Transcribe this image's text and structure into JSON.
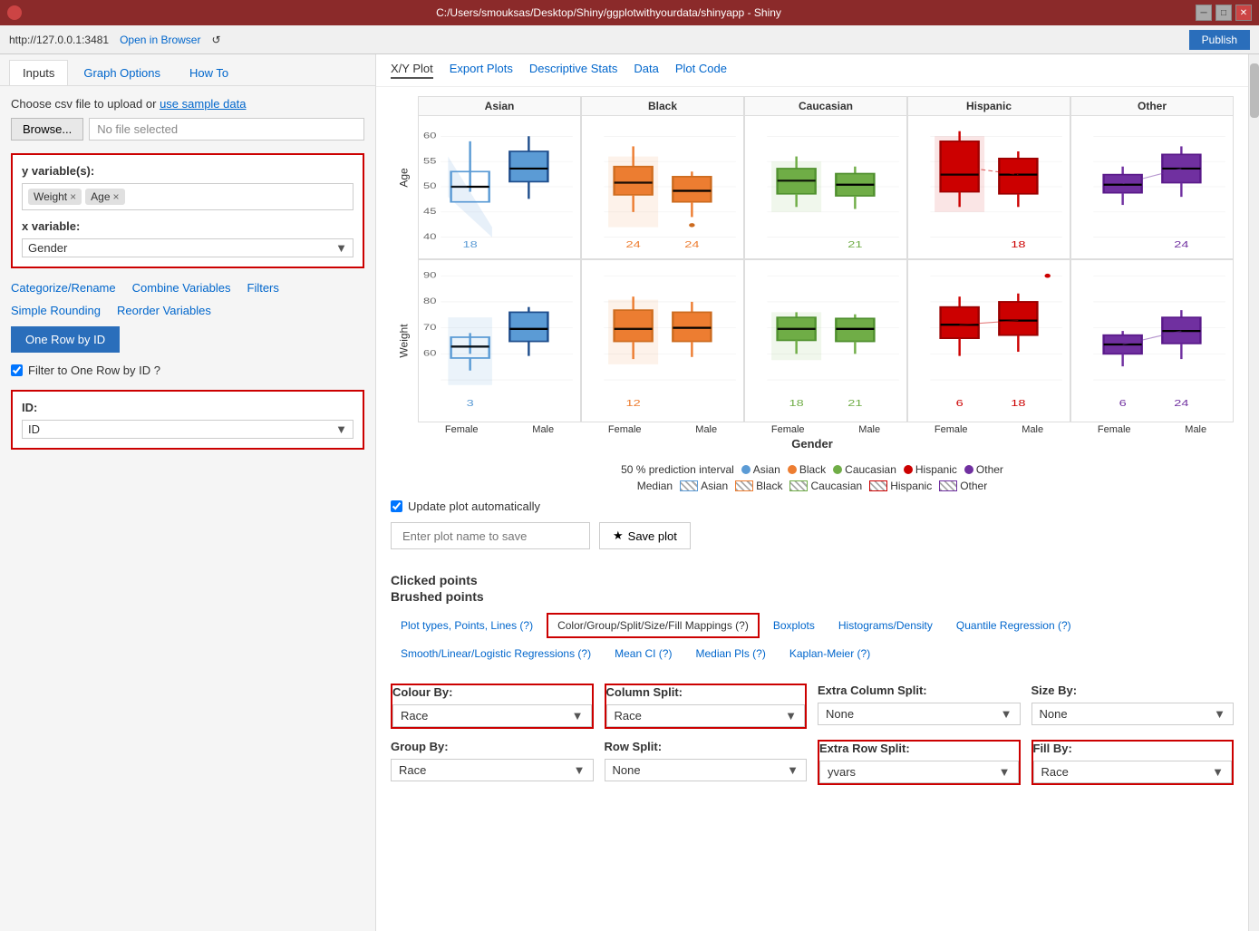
{
  "window": {
    "title": "C:/Users/smouksas/Desktop/Shiny/ggplotwithyourdata/shinyapp - Shiny",
    "url": "http://127.0.0.1:3481",
    "open_in_browser": "Open in Browser",
    "publish": "Publish"
  },
  "left_panel": {
    "tabs": [
      "Inputs",
      "Graph Options",
      "How To"
    ],
    "active_tab": "Inputs",
    "upload_label": "Choose csv file to upload",
    "upload_link": "use sample data",
    "browse_btn": "Browse...",
    "no_file": "No file selected",
    "y_variable_label": "y variable(s):",
    "y_tags": [
      "Weight",
      "Age"
    ],
    "x_variable_label": "x variable:",
    "x_value": "Gender",
    "links": [
      "Categorize/Rename",
      "Combine Variables",
      "Filters",
      "Simple Rounding",
      "Reorder Variables"
    ],
    "one_row_btn": "One Row by ID",
    "filter_checkbox": "Filter to One Row by ID ?",
    "id_label": "ID:",
    "id_value": "ID"
  },
  "right_panel": {
    "tabs": [
      "X/Y Plot",
      "Export Plots",
      "Descriptive Stats",
      "Data",
      "Plot Code"
    ],
    "active_tab": "X/Y Plot",
    "facet_columns": [
      "Asian",
      "Black",
      "Caucasian",
      "Hispanic",
      "Other"
    ],
    "facet_rows": [
      "Age",
      "Weight"
    ],
    "x_axis_title": "Gender",
    "x_labels": [
      "Female",
      "Male"
    ],
    "prediction_label": "50 % prediction interval",
    "legend_groups": [
      {
        "name": "Asian",
        "color": "#5b9bd5"
      },
      {
        "name": "Black",
        "color": "#ed7d31"
      },
      {
        "name": "Caucasian",
        "color": "#70ad47"
      },
      {
        "name": "Hispanic",
        "color": "#cc0000"
      },
      {
        "name": "Other",
        "color": "#7030a0"
      }
    ],
    "median_label": "Median",
    "median_groups": [
      "Asian",
      "Black",
      "Caucasian",
      "Hispanic",
      "Other"
    ],
    "update_checkbox": "Update plot automatically",
    "save_placeholder": "Enter plot name to save",
    "save_btn": "Save plot",
    "clicked_title": "Clicked points",
    "brushed_title": "Brushed points"
  },
  "options_tabs": [
    {
      "label": "Plot types, Points, Lines (?)",
      "active": false
    },
    {
      "label": "Color/Group/Split/Size/Fill Mappings (?)",
      "active": true
    },
    {
      "label": "Boxplots",
      "active": false
    },
    {
      "label": "Histograms/Density",
      "active": false
    },
    {
      "label": "Quantile Regression (?)",
      "active": false
    },
    {
      "label": "Smooth/Linear/Logistic Regressions (?)",
      "active": false
    },
    {
      "label": "Mean CI (?)",
      "active": false
    },
    {
      "label": "Median Pls (?)",
      "active": false
    },
    {
      "label": "Kaplan-Meier (?)",
      "active": false
    }
  ],
  "mappings": {
    "colour_by": {
      "label": "Colour By:",
      "value": "Race",
      "red_border": true
    },
    "column_split": {
      "label": "Column Split:",
      "value": "Race",
      "red_border": true
    },
    "extra_column_split": {
      "label": "Extra Column Split:",
      "value": "None",
      "red_border": false
    },
    "size_by": {
      "label": "Size By:",
      "value": "None",
      "red_border": false
    },
    "group_by": {
      "label": "Group By:",
      "value": "Race",
      "red_border": false
    },
    "row_split": {
      "label": "Row Split:",
      "value": "None",
      "red_border": false
    },
    "extra_row_split": {
      "label": "Extra Row Split:",
      "value": "yvars",
      "red_border": true
    },
    "fill_by": {
      "label": "Fill By:",
      "value": "Race",
      "red_border": true
    }
  }
}
